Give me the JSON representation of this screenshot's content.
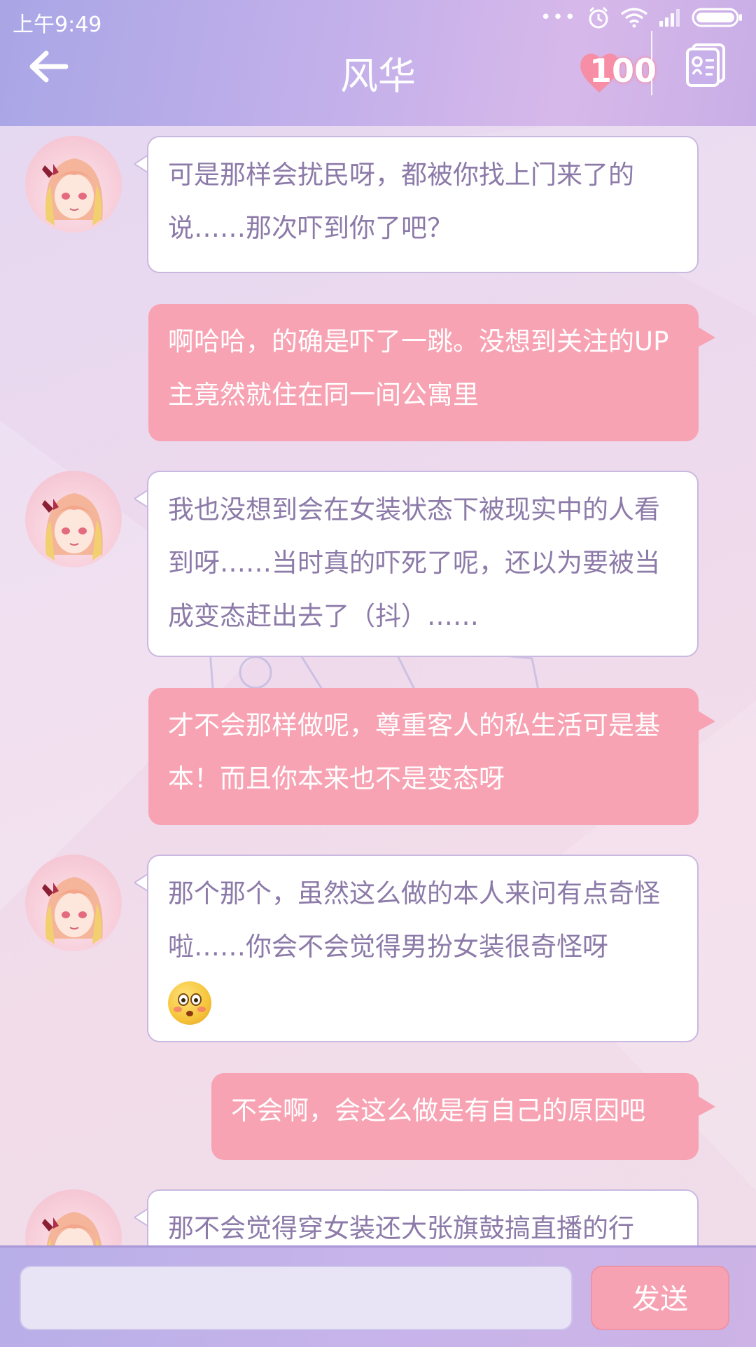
{
  "status_bar": {
    "time": "上午9:49",
    "dots": "•••"
  },
  "header": {
    "title": "风华",
    "affection": "100"
  },
  "messages": [
    {
      "from": "them",
      "text": "可是那样会扰民呀，都被你找上门来了的说……那次吓到你了吧？"
    },
    {
      "from": "me",
      "text": "啊哈哈，的确是吓了一跳。没想到关注的UP主竟然就住在同一间公寓里"
    },
    {
      "from": "them",
      "text": "我也没想到会在女装状态下被现实中的人看到呀……当时真的吓死了呢，还以为要被当成变态赶出去了（抖）……"
    },
    {
      "from": "me",
      "text": "才不会那样做呢，尊重客人的私生活可是基本！而且你本来也不是变态呀"
    },
    {
      "from": "them",
      "text": "那个那个，虽然这么做的本人来问有点奇怪啦……你会不会觉得男扮女装很奇怪呀"
    },
    {
      "from": "me",
      "text": "不会啊，会这么做是有自己的原因吧"
    },
    {
      "from": "them",
      "text": "那不会觉得穿女装还大张旗鼓搞直播的行"
    }
  ],
  "composer": {
    "placeholder": "",
    "send_label": "发送"
  },
  "colors": {
    "incoming_bubble": "#ffffff",
    "outgoing_bubble": "#f7a3b3",
    "incoming_text": "#8c7aa8",
    "header": "#c3b0ea"
  }
}
